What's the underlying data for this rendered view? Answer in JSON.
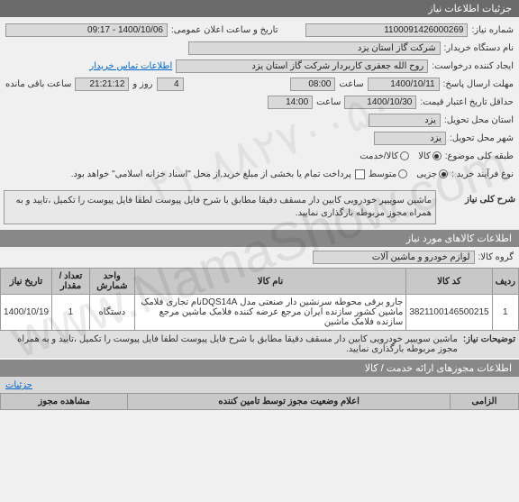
{
  "header": {
    "title": "جزئیات اطلاعات نیاز"
  },
  "form": {
    "need_no_label": "شماره نیاز:",
    "need_no": "1100091426000269",
    "announce_label": "تاریخ و ساعت اعلان عمومی:",
    "announce": "1400/10/06 - 09:17",
    "buyer_label": "نام دستگاه خریدار:",
    "buyer": "شرکت گاز استان یزد",
    "requester_label": "ایجاد کننده درخواست:",
    "requester": "روح الله جعفری کاربردار شرکت گاز استان یزد",
    "contact_link": "اطلاعات تماس خریدار",
    "deadline_label": "مهلت ارسال پاسخ:",
    "deadline_date": "1400/10/11",
    "time_label": "ساعت",
    "deadline_time": "08:00",
    "remain_label": "روز و",
    "remain_days": "4",
    "remain_time": "21:21:12",
    "remain_suffix": "ساعت باقی مانده",
    "validity_label": "حداقل تاریخ اعتبار قیمت:",
    "validity_date": "1400/10/30",
    "validity_time": "14:00",
    "loc_label": "استان محل تحویل:",
    "loc_province": "یزد",
    "city_label": "شهر محل تحویل:",
    "loc_city": "یزد",
    "category_label": "طبقه کلی موضوع:",
    "cat_goods": "کالا",
    "cat_service": "کالا/خدمت",
    "process_label": "نوع فرآیند خرید :",
    "proc_partial": "جزیی",
    "proc_medium": "متوسط",
    "payment_note": "پرداخت تمام یا بخشی از مبلغ خرید,از محل \"اسناد خزانه اسلامی\" خواهد بود."
  },
  "general_desc": {
    "title": "شرح کلی نیاز",
    "text": "ماشین سوییپر خودرویی کابین دار مسقف دقیقا مطابق با شرح فایل پیوست لطفا فایل پیوست را تکمیل ،تایید و به همراه مجوز مربوطه بارگذاری نمایید."
  },
  "items_section": {
    "title": "اطلاعات کالاهای مورد نیاز",
    "group_label": "گروه کالا:",
    "group_value": "لوازم خودرو و ماشین آلات",
    "headers": {
      "row": "ردیف",
      "code": "کد کالا",
      "name": "نام کالا",
      "unit": "واحد شمارش",
      "qty": "تعداد / مقدار",
      "date": "تاریخ نیاز"
    },
    "rows": [
      {
        "row": "1",
        "code": "3821100146500215",
        "name": "جارو برقی محوطه سرنشین دار صنعتی مدل DQS14Aنام تجاری فلامک ماشین کشور سازنده ایران مرجع عرضه کننده فلامک ماشین مرجع سازنده فلامک ماشین",
        "unit": "دستگاه",
        "qty": "1",
        "date": "1400/10/19"
      }
    ],
    "notes_label": "توضیحات نیاز:",
    "notes_text": "ماشین سوییپر خودرویی کابین دار مسقف دقیقا مطابق با شرح فایل پیوست لطفا فایل پیوست را تکمیل ،تایید و به همراه مجوز مربوطه بارگذاری نمایید."
  },
  "license_section": {
    "title": "اطلاعات مجوزهای ارائه خدمت / کالا",
    "details_label": "جزئیات",
    "col1": "الزامی",
    "col2": "اعلام وضعیت مجوز توسط تامین کننده",
    "col3": "مشاهده مجوز"
  }
}
